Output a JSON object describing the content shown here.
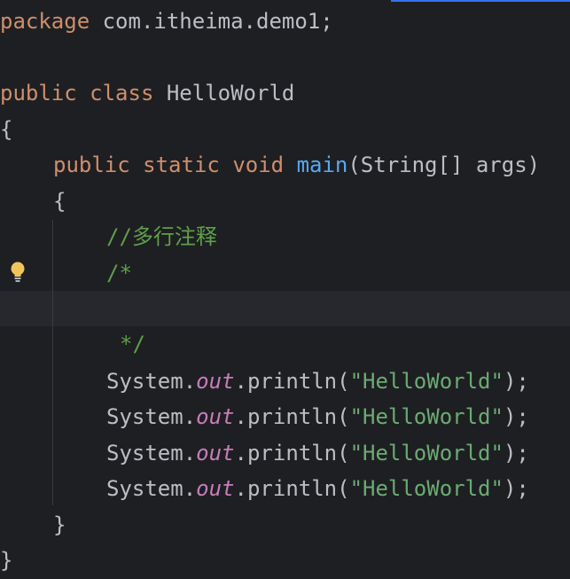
{
  "colors": {
    "background": "#1e1f22",
    "keyword": "#cf8e6d",
    "method": "#56a8f5",
    "string": "#6aab73",
    "comment": "#5f9f4a",
    "static_field": "#c77dbb",
    "text": "#bcbec4"
  },
  "code": {
    "l1": {
      "kw": "package",
      "text": " com.itheima.demo1;"
    },
    "l3": {
      "kw1": "public",
      "kw2": "class",
      "text": " HelloWorld"
    },
    "l4": {
      "text": "{"
    },
    "l5": {
      "kw1": "public",
      "kw2": "static",
      "kw3": "void",
      "method": "main",
      "text": "(String[] args)"
    },
    "l6": {
      "text": "{"
    },
    "l7": {
      "comment": "//多行注释"
    },
    "l8": {
      "comment": "/*"
    },
    "l10": {
      "comment": "*/"
    },
    "println_rows": [
      {
        "obj": "System.",
        "field": "out",
        "call": ".println(",
        "string": "\"HelloWorld\"",
        "end": ");"
      },
      {
        "obj": "System.",
        "field": "out",
        "call": ".println(",
        "string": "\"HelloWorld\"",
        "end": ");"
      },
      {
        "obj": "System.",
        "field": "out",
        "call": ".println(",
        "string": "\"HelloWorld\"",
        "end": ");"
      },
      {
        "obj": "System.",
        "field": "out",
        "call": ".println(",
        "string": "\"HelloWorld\"",
        "end": ");"
      }
    ],
    "l15": {
      "text": "}"
    },
    "l16": {
      "text": "}"
    }
  },
  "gutter": {
    "intention_icon": "lightbulb-icon"
  }
}
